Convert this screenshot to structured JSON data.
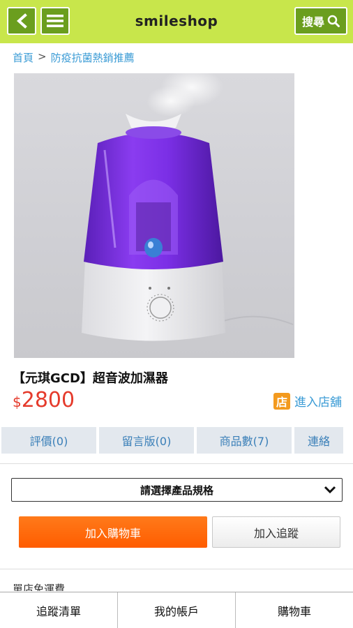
{
  "header": {
    "title": "smileshop",
    "search_label": "搜尋"
  },
  "breadcrumb": {
    "home": "首頁",
    "separator": ">",
    "category": "防疫抗菌熱銷推薦"
  },
  "product": {
    "name": "【元琪GCD】超音波加濕器",
    "currency": "$",
    "price": "2800",
    "store_icon_char": "店",
    "store_link": "進入店舖"
  },
  "tabs": [
    {
      "label": "評價(0)"
    },
    {
      "label": "留言版(0)"
    },
    {
      "label": "商品數(7)"
    },
    {
      "label": "連絡"
    }
  ],
  "spec_select": {
    "placeholder": "請選擇產品規格"
  },
  "actions": {
    "add_to_cart": "加入購物車",
    "add_to_track": "加入追蹤"
  },
  "section_peek": "單店免運費",
  "bottom_nav": [
    {
      "label": "追蹤清單"
    },
    {
      "label": "我的帳戶"
    },
    {
      "label": "購物車"
    }
  ],
  "colors": {
    "header_bg": "#c8e64b",
    "header_button": "#6b9e1e",
    "link": "#3a9bd5",
    "price": "#e53b2c",
    "cart_button": "#ff6a00",
    "store_icon": "#f39a1e"
  },
  "icons": {
    "back": "chevron-left-icon",
    "menu": "hamburger-menu-icon",
    "search": "search-icon",
    "store": "store-icon",
    "dropdown": "chevron-down-icon"
  }
}
